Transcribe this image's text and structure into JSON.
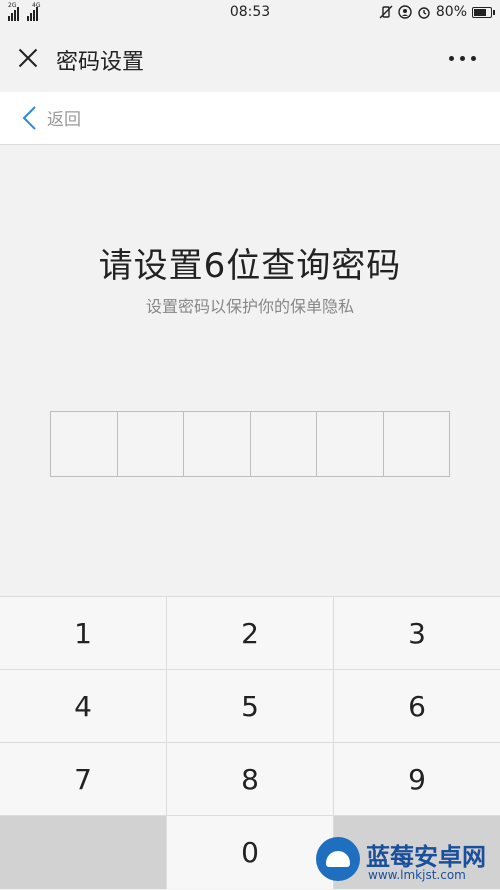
{
  "status_bar": {
    "network_left": "2G",
    "network_right": "4G",
    "time": "08:53",
    "battery": "80%",
    "battery_level": 0.8,
    "icons": [
      "signal-icon",
      "vibrate-off-icon",
      "location-icon",
      "alarm-icon",
      "battery-icon"
    ]
  },
  "title_bar": {
    "title": "密码设置",
    "close_icon": "close-icon",
    "more_icon": "more-icon"
  },
  "back_bar": {
    "label": "返回",
    "icon": "chevron-left-icon",
    "icon_color": "#2a8ad8"
  },
  "content": {
    "heading": "请设置6位查询密码",
    "subheading": "设置密码以保护你的保单隐私",
    "password_length": 6
  },
  "keypad": {
    "rows": [
      [
        "1",
        "2",
        "3"
      ],
      [
        "4",
        "5",
        "6"
      ],
      [
        "7",
        "8",
        "9"
      ],
      [
        "",
        "0",
        ""
      ]
    ]
  },
  "watermark": {
    "name": "蓝莓安卓网",
    "url": "www.lmkjst.com"
  }
}
